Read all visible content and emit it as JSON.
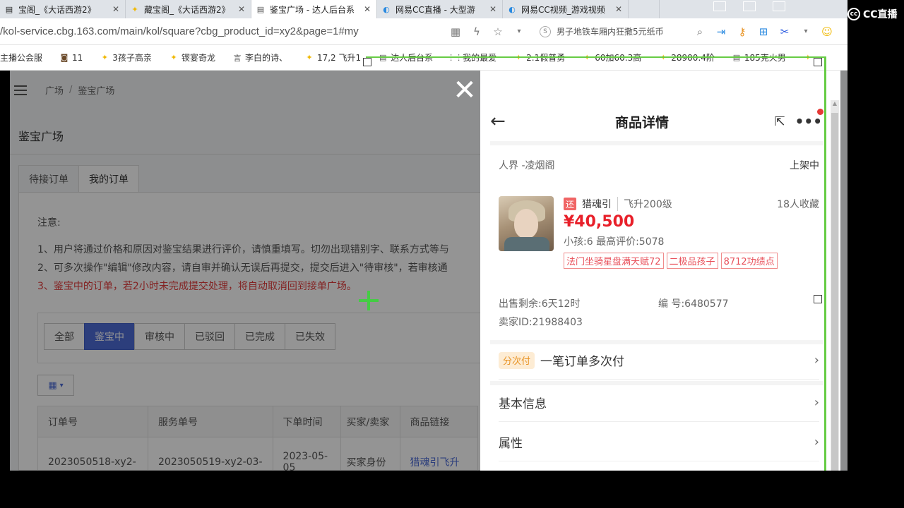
{
  "browser": {
    "tabs": [
      {
        "icon": "text-icon",
        "title": "宝阁_《大话西游2》",
        "active": false
      },
      {
        "icon": "game-icon",
        "title": "藏宝阁_《大话西游2》",
        "active": false
      },
      {
        "icon": "doc-icon",
        "title": "鉴宝广场 - 达人后台系",
        "active": true
      },
      {
        "icon": "cc-icon",
        "title": "网易CC直播 - 大型游",
        "active": false
      },
      {
        "icon": "cc-icon",
        "title": "网易CC视频_游戏视频",
        "active": false
      }
    ],
    "close_glyph": "✕",
    "url": "/kol-service.cbg.163.com/main/kol/square?cbg_product_id=xy2&page=1#my",
    "search_text": "男子地铁车厢内狂撒5元纸币",
    "bookmarks": [
      {
        "icon": "text-icon",
        "label": "主播公会服"
      },
      {
        "icon": "camera-icon",
        "label": "11"
      },
      {
        "icon": "game-icon",
        "label": "3孩子高亲"
      },
      {
        "icon": "game-icon",
        "label": "锲宴奇龙"
      },
      {
        "icon": "text-icon",
        "label": "李白的诗、"
      },
      {
        "icon": "game-icon",
        "label": "17,2 飞升1"
      },
      {
        "icon": "doc-icon",
        "label": "达人后台系"
      },
      {
        "icon": "apps-icon",
        "label": "我的最爱"
      },
      {
        "icon": "game-icon",
        "label": "2.1假普勇"
      },
      {
        "icon": "game-icon",
        "label": "60加60.3高"
      },
      {
        "icon": "game-icon",
        "label": "28900.4阶"
      },
      {
        "icon": "doc-icon",
        "label": "185克火男"
      }
    ]
  },
  "page": {
    "breadcrumb": [
      "广场",
      "鉴宝广场"
    ],
    "breadcrumb_sep": "/",
    "section_title": "鉴宝广场",
    "order_tabs": [
      "待接订单",
      "我的订单"
    ],
    "notice_head": "注意:",
    "notice_lines": [
      "1、用户将通过价格和原因对鉴宝结果进行评价，请慎重填写。切勿出现错别字、联系方式等与",
      "2、可多次操作\"编辑\"修改内容，请自审并确认无误后再提交，提交后进入\"待审核\"，若审核通"
    ],
    "notice_warning": "3、鉴宝中的订单，若2小时未完成提交处理，将自动取消回到接单广场。",
    "filters": [
      {
        "label": "全部",
        "active": false
      },
      {
        "label": "鉴宝中",
        "active": true
      },
      {
        "label": "审核中",
        "active": false
      },
      {
        "label": "已驳回",
        "active": false
      },
      {
        "label": "已完成",
        "active": false
      },
      {
        "label": "已失效",
        "active": false
      }
    ],
    "table_headers": [
      "订单号",
      "服务单号",
      "下单时间",
      "买家/卖家",
      "商品链接"
    ],
    "table_row": [
      "2023050518-xy2-",
      "2023050519-xy2-03-",
      "2023-05-\n05",
      "买家身份",
      "猎魂引飞升"
    ],
    "close_glyph": "✕"
  },
  "detail": {
    "title": "商品详情",
    "realm": "人界 -凌烟阁",
    "status": "上架中",
    "type_tag": "还",
    "name": "猎魂引",
    "level": "飞升200级",
    "favorites": "18人收藏",
    "price": "¥40,500",
    "sub": "小孩:6 最高评价:5078",
    "tags": [
      "法门坐骑星盘满天赋72",
      "二极品孩子",
      "8712功绩点"
    ],
    "remaining": "出售剩余:6天12时",
    "serial": "编 号:6480577",
    "seller": "卖家ID:21988403",
    "installment_badge": "分次付",
    "installment_label": "一笔订单多次付",
    "rows": [
      "基本信息",
      "属性"
    ]
  },
  "overlay": {
    "brand": "CC直播"
  },
  "colors": {
    "accent_blue": "#4d6cd6",
    "price_red": "#e8202a",
    "frame_green": "#66cc44"
  }
}
